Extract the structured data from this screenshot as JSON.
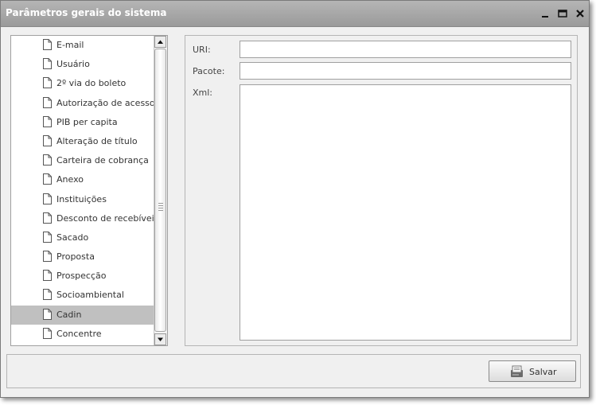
{
  "window": {
    "title": "Parâmetros gerais do sistema"
  },
  "tree": {
    "items": [
      {
        "label": "E-mail",
        "selected": false
      },
      {
        "label": "Usuário",
        "selected": false
      },
      {
        "label": "2º via do boleto",
        "selected": false
      },
      {
        "label": "Autorização de acesso",
        "selected": false
      },
      {
        "label": "PIB per capita",
        "selected": false
      },
      {
        "label": "Alteração de título",
        "selected": false
      },
      {
        "label": "Carteira de cobrança",
        "selected": false
      },
      {
        "label": "Anexo",
        "selected": false
      },
      {
        "label": "Instituições",
        "selected": false
      },
      {
        "label": "Desconto de recebíveis",
        "selected": false
      },
      {
        "label": "Sacado",
        "selected": false
      },
      {
        "label": "Proposta",
        "selected": false
      },
      {
        "label": "Prospecção",
        "selected": false
      },
      {
        "label": "Socioambiental",
        "selected": false
      },
      {
        "label": "Cadin",
        "selected": true
      },
      {
        "label": "Concentre",
        "selected": false
      }
    ]
  },
  "form": {
    "uri_label": "URI:",
    "uri_value": "",
    "pacote_label": "Pacote:",
    "pacote_value": "",
    "xml_label": "Xml:",
    "xml_value": ""
  },
  "toolbar": {
    "save_label": "Salvar"
  },
  "icons": {
    "minimize": "minimize-icon",
    "maximize": "maximize-icon",
    "close": "close-icon",
    "document": "document-icon",
    "save": "save-disk-icon"
  }
}
